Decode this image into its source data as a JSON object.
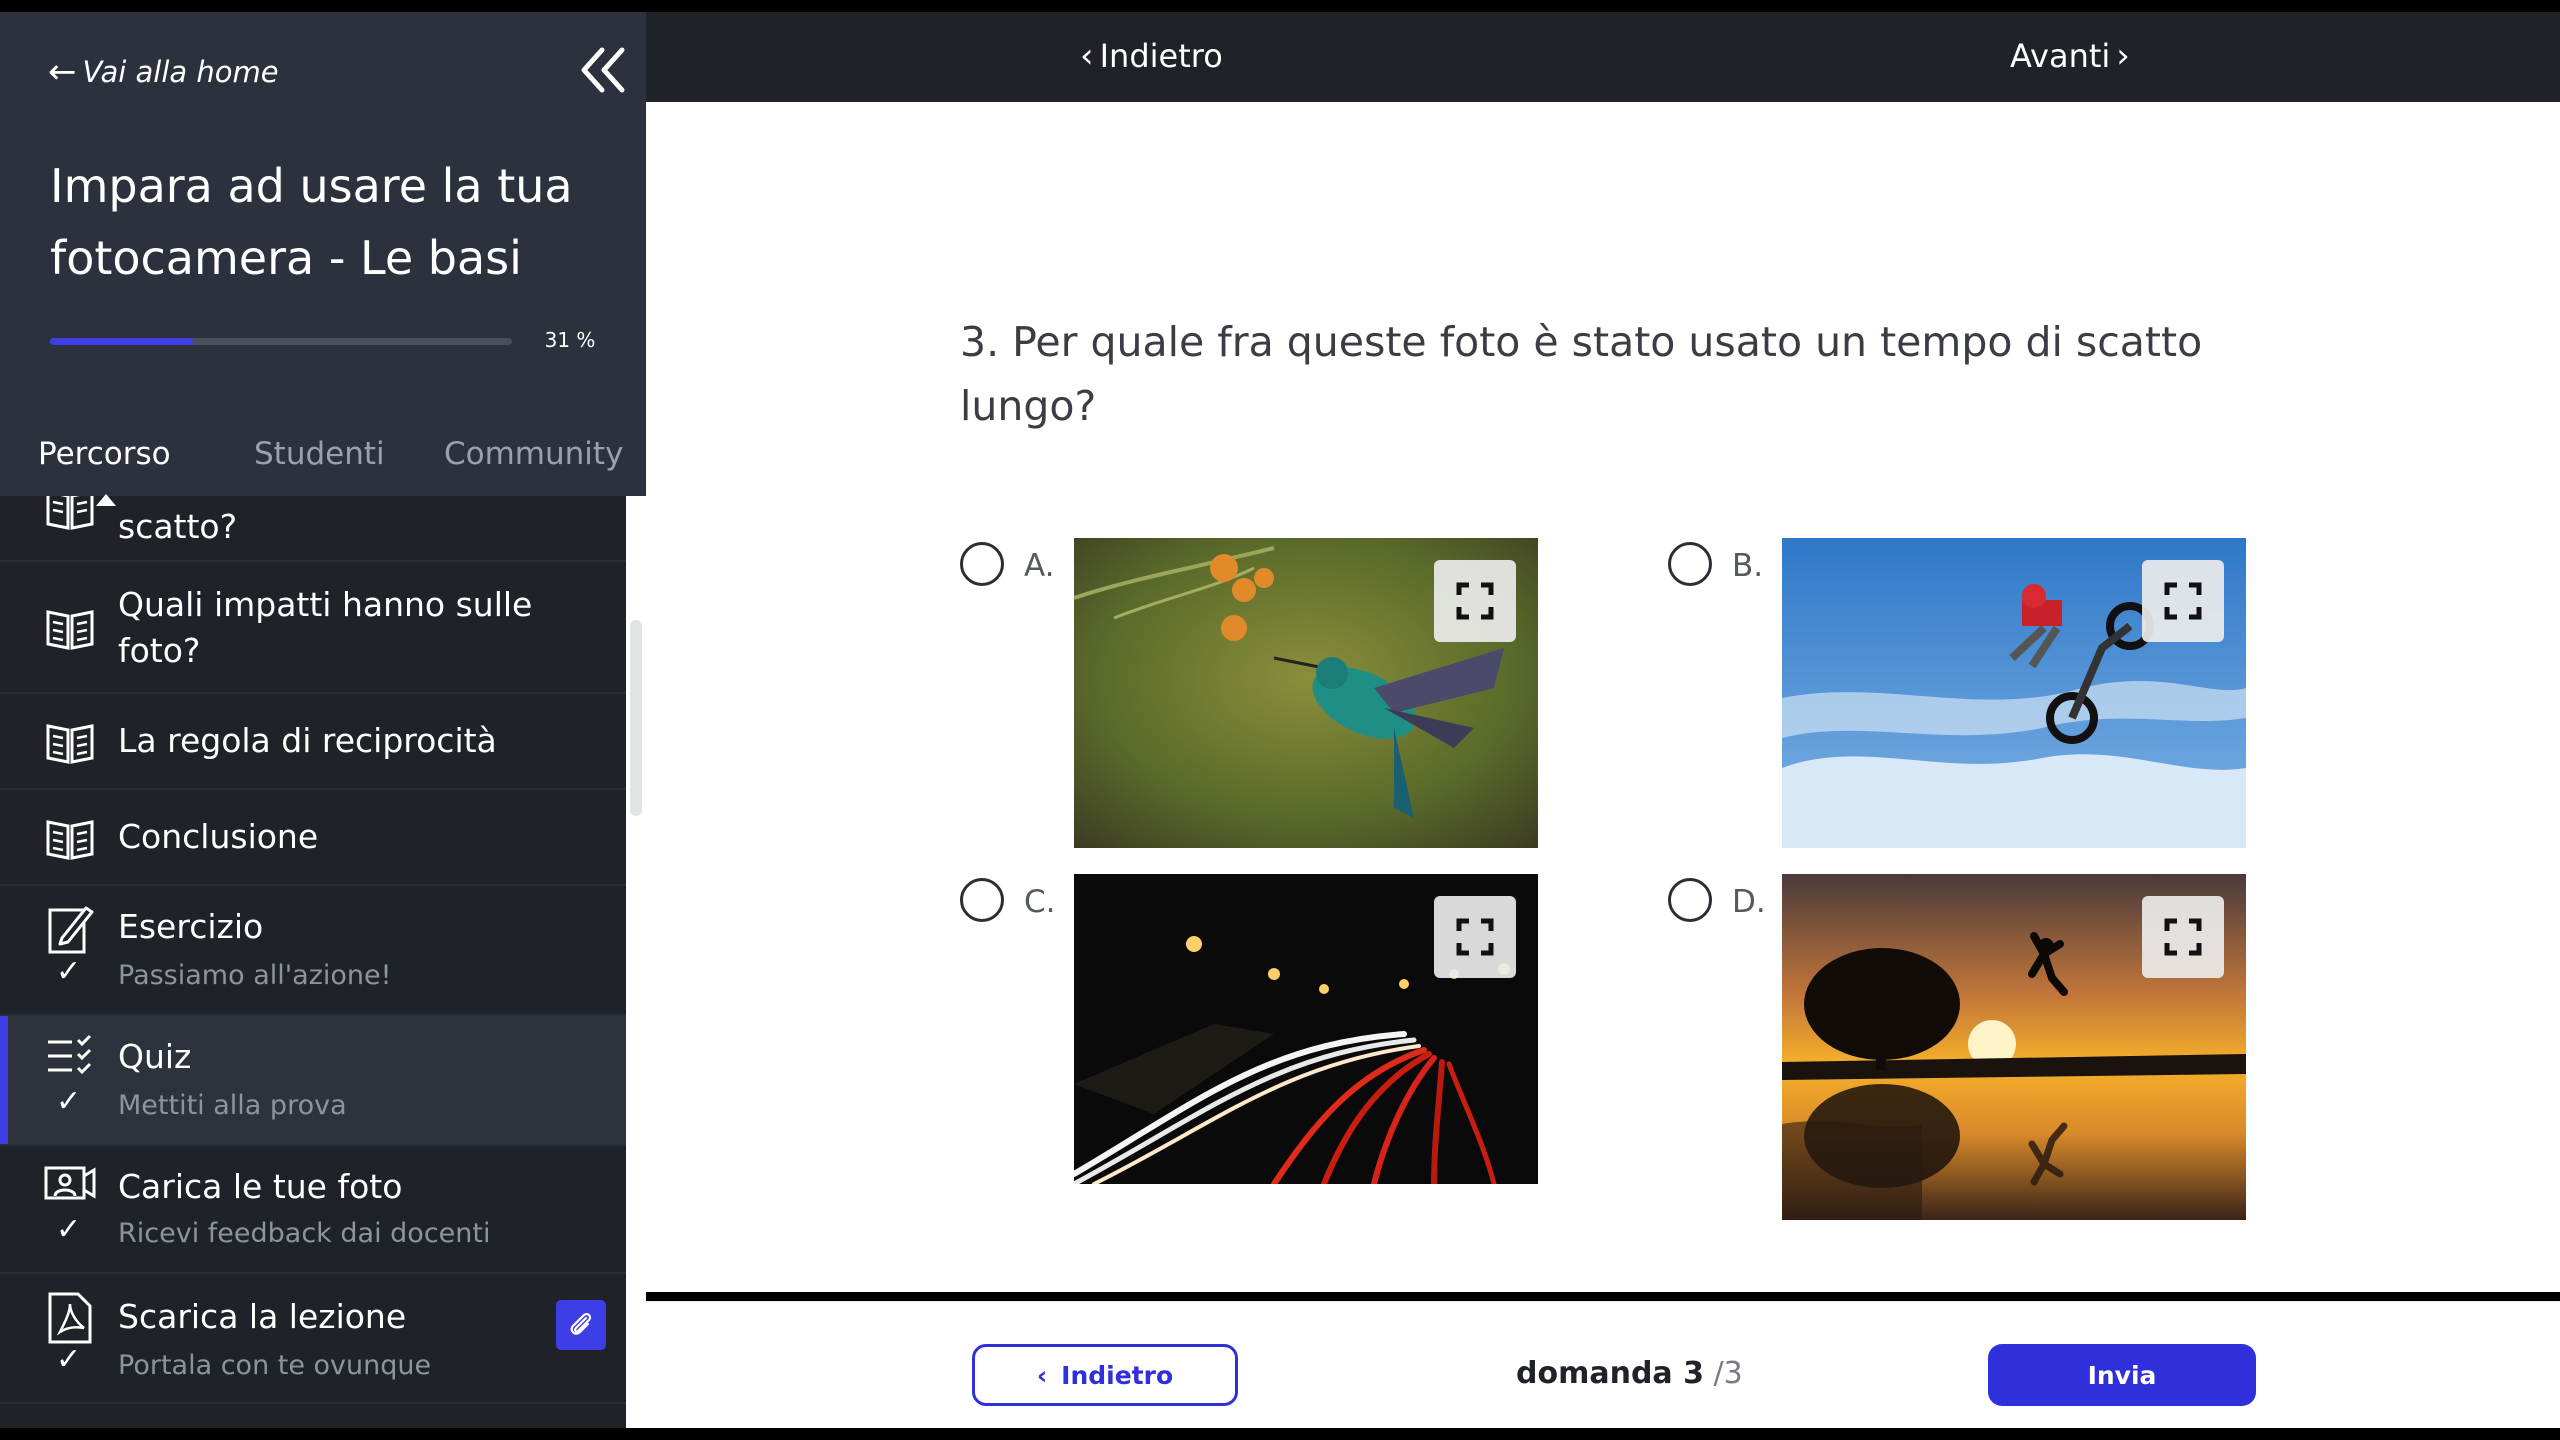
{
  "sidebar": {
    "back_home": "Vai alla home",
    "course_title": "Impara ad usare la tua fotocamera - Le basi",
    "progress_percent": 31,
    "progress_label": "31 %",
    "tabs": [
      {
        "label": "Percorso",
        "active": true
      },
      {
        "label": "Studenti",
        "active": false
      },
      {
        "label": "Community",
        "active": false
      }
    ],
    "items": [
      {
        "title": "scatto?",
        "icon": "book-icon"
      },
      {
        "title": "Quali impatti hanno sulle foto?",
        "icon": "book-icon"
      },
      {
        "title": "La regola di reciprocità",
        "icon": "book-icon"
      },
      {
        "title": "Conclusione",
        "icon": "book-icon"
      },
      {
        "title": "Esercizio",
        "subtitle": "Passiamo all'azione!",
        "icon": "exercise-icon",
        "check": "✓"
      },
      {
        "title": "Quiz",
        "subtitle": "Mettiti alla prova",
        "icon": "quiz-icon",
        "check": "✓",
        "active": true
      },
      {
        "title": "Carica le tue foto",
        "subtitle": "Ricevi feedback dai docenti",
        "icon": "upload-photo-icon",
        "check": "✓"
      },
      {
        "title": "Scarica la lezione",
        "subtitle": "Portala con te ovunque",
        "icon": "pdf-icon",
        "check": "✓",
        "attachment_icon": "paperclip-icon"
      }
    ]
  },
  "topnav": {
    "back_label": "Indietro",
    "next_label": "Avanti"
  },
  "question": {
    "text": "3. Per quale fra queste foto è stato usato un tempo di scatto lungo?",
    "options": [
      {
        "letter": "A.",
        "image": "hummingbird-photo"
      },
      {
        "letter": "B.",
        "image": "motocross-jump-photo"
      },
      {
        "letter": "C.",
        "image": "night-traffic-light-trails-photo"
      },
      {
        "letter": "D.",
        "image": "sunset-jump-silhouette-photo"
      }
    ]
  },
  "footer": {
    "prev_label": "Indietro",
    "counter_label": "domanda 3",
    "counter_total": "/3",
    "submit_label": "Invia"
  },
  "colors": {
    "accent": "#2f2fdc",
    "sidebar_bg": "#1f2229",
    "sidebar_header_bg": "#2c313d"
  }
}
